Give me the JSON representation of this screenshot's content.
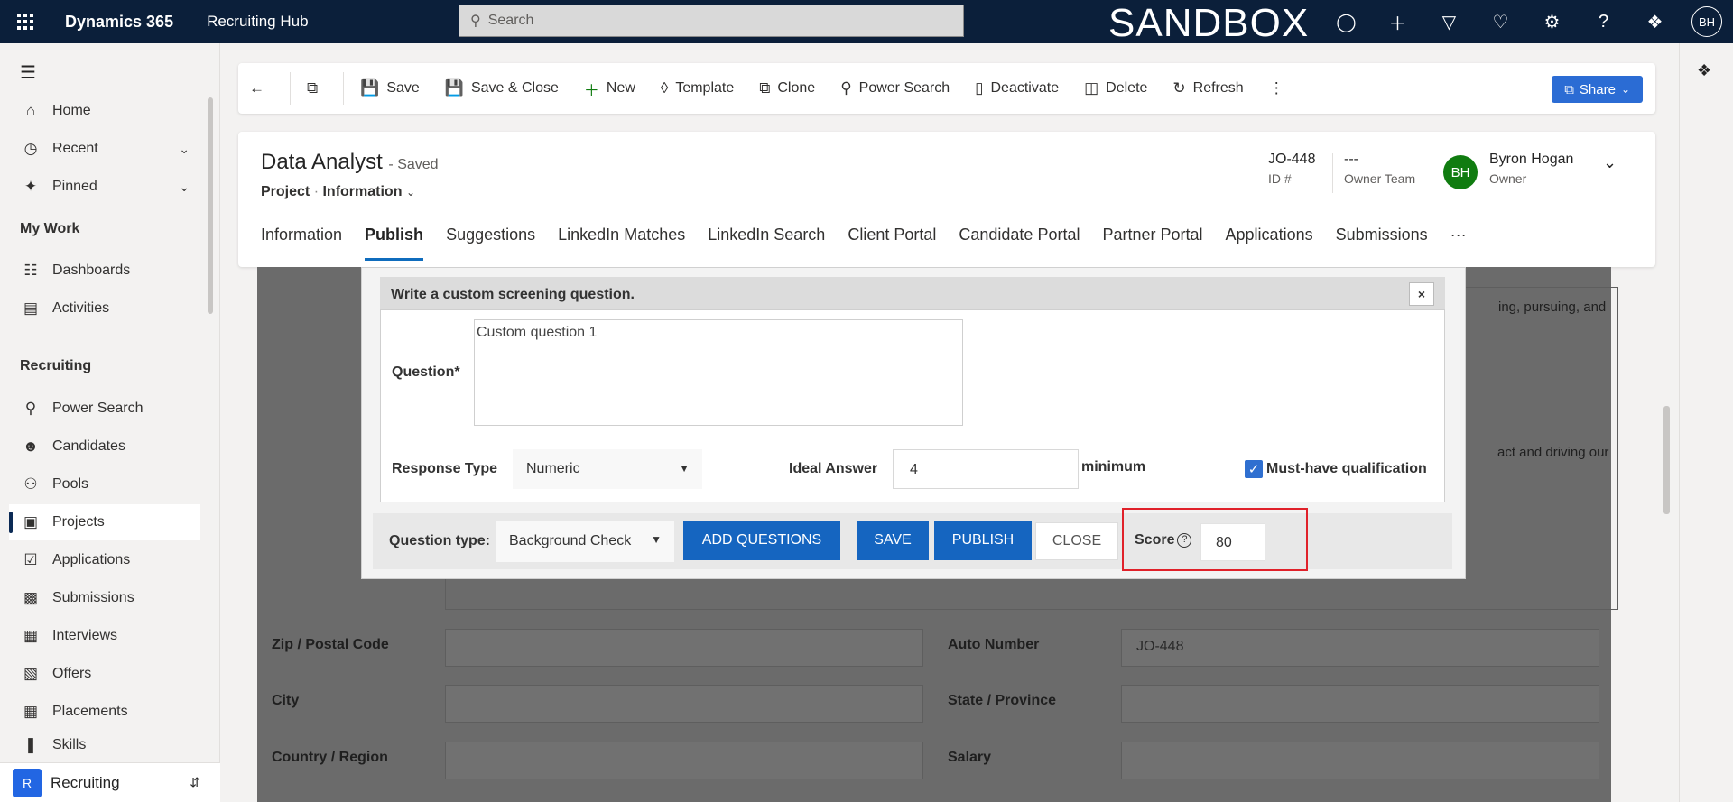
{
  "topbar": {
    "app_name": "Dynamics 365",
    "hub_name": "Recruiting Hub",
    "search_placeholder": "Search",
    "environment_label": "SANDBOX",
    "user_initials": "BH"
  },
  "nav": {
    "items": [
      {
        "label": "Home",
        "icon": "home-icon"
      },
      {
        "label": "Recent",
        "icon": "clock-icon"
      },
      {
        "label": "Pinned",
        "icon": "pin-icon"
      },
      {
        "label": "Dashboards",
        "icon": "dashboard-icon"
      },
      {
        "label": "Activities",
        "icon": "clipboard-icon"
      },
      {
        "label": "Power Search",
        "icon": "search-icon"
      },
      {
        "label": "Candidates",
        "icon": "person-icon"
      },
      {
        "label": "Pools",
        "icon": "group-icon"
      },
      {
        "label": "Projects",
        "icon": "briefcase-icon"
      },
      {
        "label": "Applications",
        "icon": "check-doc-icon"
      },
      {
        "label": "Submissions",
        "icon": "id-card-icon"
      },
      {
        "label": "Interviews",
        "icon": "calendar-icon"
      },
      {
        "label": "Offers",
        "icon": "offer-icon"
      },
      {
        "label": "Placements",
        "icon": "placement-icon"
      },
      {
        "label": "Skills",
        "icon": "skills-icon"
      }
    ],
    "group_my_work": "My Work",
    "group_recruiting": "Recruiting",
    "area_badge": "R",
    "area_label": "Recruiting"
  },
  "commands": {
    "save": "Save",
    "save_close": "Save & Close",
    "new": "New",
    "template": "Template",
    "clone": "Clone",
    "power_search": "Power Search",
    "deactivate": "Deactivate",
    "delete": "Delete",
    "refresh": "Refresh",
    "share": "Share"
  },
  "record": {
    "title": "Data Analyst",
    "saved_status": "- Saved",
    "entity": "Project",
    "form_name": "Information",
    "id_value": "JO-448",
    "id_label": "ID #",
    "owner_team_value": "---",
    "owner_team_label": "Owner Team",
    "owner_initials": "BH",
    "owner_name": "Byron Hogan",
    "owner_label": "Owner"
  },
  "tabs": [
    "Information",
    "Publish",
    "Suggestions",
    "LinkedIn Matches",
    "LinkedIn Search",
    "Client Portal",
    "Candidate Portal",
    "Partner Portal",
    "Applications",
    "Submissions"
  ],
  "tabs_more": "···",
  "background_form": {
    "text_fragment_1": "ing, pursuing, and",
    "text_fragment_2": "act and driving our",
    "zip_label": "Zip / Postal Code",
    "auto_number_label": "Auto Number",
    "auto_number_value": "JO-448",
    "city_label": "City",
    "state_label": "State / Province",
    "country_label": "Country / Region",
    "salary_label": "Salary"
  },
  "modal": {
    "header": "Write a custom screening question.",
    "close_x": "×",
    "question_label": "Question*",
    "question_value": "Custom question 1",
    "response_type_label": "Response Type",
    "response_type_value": "Numeric",
    "ideal_answer_label": "Ideal Answer",
    "ideal_answer_value": "4",
    "ideal_answer_suffix": "minimum",
    "must_have_label": "Must-have qualification",
    "must_have_checked": true,
    "question_type_label": "Question type:",
    "question_type_value": "Background Check",
    "add_questions_btn": "ADD QUESTIONS",
    "save_btn": "SAVE",
    "publish_btn": "PUBLISH",
    "close_btn": "CLOSE",
    "score_label": "Score",
    "score_help": "?",
    "score_value": "80"
  },
  "colors": {
    "topbar": "#0b1f3a",
    "accent": "#2266e3",
    "button_blue": "#1565c0",
    "highlight_red": "#e0212a",
    "owner_green": "#107c10"
  }
}
